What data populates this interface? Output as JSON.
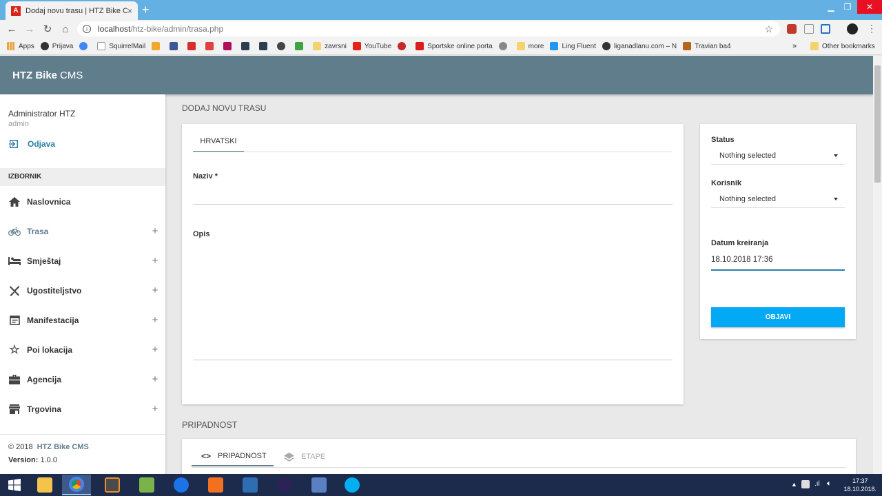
{
  "browser": {
    "tab_title": "Dodaj novu trasu | HTZ Bike CMS",
    "tab_close": "×",
    "new_tab": "+",
    "url_host": "localhost",
    "url_path": "/htz-bike/admin/trasa.php",
    "bookmarks": [
      {
        "label": "Apps",
        "color": "#e8a33d"
      },
      {
        "label": "Prijava",
        "color": "#333333"
      },
      {
        "label": "",
        "color": "#4285f4"
      },
      {
        "label": "SquirrelMail",
        "color": "#bbbbbb"
      },
      {
        "label": "",
        "color": "#f0a830"
      },
      {
        "label": "",
        "color": "#3b5998"
      },
      {
        "label": "",
        "color": "#d62d2d"
      },
      {
        "label": "",
        "color": "#e04040"
      },
      {
        "label": "",
        "color": "#b0105a"
      },
      {
        "label": "",
        "color": "#2c3e50"
      },
      {
        "label": "",
        "color": "#2c3e50"
      },
      {
        "label": "",
        "color": "#444444"
      },
      {
        "label": "",
        "color": "#3fa33f"
      },
      {
        "label": "zavrsni",
        "color": "#f5d36c"
      },
      {
        "label": "YouTube",
        "color": "#e62117"
      },
      {
        "label": "",
        "color": "#c62828"
      },
      {
        "label": "Sportske online porta",
        "color": "#d81e1e"
      },
      {
        "label": "",
        "color": "#888888"
      },
      {
        "label": "more",
        "color": "#f5d36c"
      },
      {
        "label": "Ling Fluent",
        "color": "#2196f3"
      },
      {
        "label": "liganadlanu.com – N",
        "color": "#333333"
      },
      {
        "label": "Travian ba4",
        "color": "#b5651d"
      }
    ],
    "bookmarks_more": "»",
    "other_bookmarks": "Other bookmarks"
  },
  "app": {
    "brand_bold": "HTZ Bike",
    "brand_rest": "CMS"
  },
  "sidebar": {
    "user_name": "Administrator HTZ",
    "user_role": "admin",
    "logout_label": "Odjava",
    "menu_header": "IZBORNIK",
    "items": [
      {
        "label": "Naslovnica",
        "icon": "home-icon",
        "plus": ""
      },
      {
        "label": "Trasa",
        "icon": "bike-icon",
        "plus": "+"
      },
      {
        "label": "Smještaj",
        "icon": "bed-icon",
        "plus": "+"
      },
      {
        "label": "Ugostiteljstvo",
        "icon": "cutlery-icon",
        "plus": "+"
      },
      {
        "label": "Manifestacija",
        "icon": "calendar-icon",
        "plus": "+"
      },
      {
        "label": "Poi lokacija",
        "icon": "star-icon",
        "plus": "+"
      },
      {
        "label": "Agencija",
        "icon": "briefcase-icon",
        "plus": "+"
      },
      {
        "label": "Trgovina",
        "icon": "store-icon",
        "plus": "+"
      }
    ],
    "footer_year": "© 2018",
    "footer_brand": "HTZ Bike CMS",
    "version_label": "Version:",
    "version_value": "1.0.0"
  },
  "main": {
    "page_title": "DODAJ NOVU TRASU",
    "lang_tab": "HRVATSKI",
    "naziv_label": "Naziv *",
    "opis_label": "Opis",
    "section2_title": "PRIPADNOST",
    "tabs": [
      {
        "label": "PRIPADNOST",
        "icon": "code-icon"
      },
      {
        "label": "ETAPE",
        "icon": "layers-icon"
      }
    ]
  },
  "side_panel": {
    "status_label": "Status",
    "status_value": "Nothing selected",
    "korisnik_label": "Korisnik",
    "korisnik_value": "Nothing selected",
    "datum_label": "Datum kreiranja",
    "datum_value": "18.10.2018 17:36",
    "publish_label": "OBJAVI"
  },
  "taskbar": {
    "time": "17:37",
    "date": "18.10.2018."
  },
  "colors": {
    "header": "#607d8b",
    "accent": "#03a9f4",
    "link": "#2b7fa8"
  }
}
